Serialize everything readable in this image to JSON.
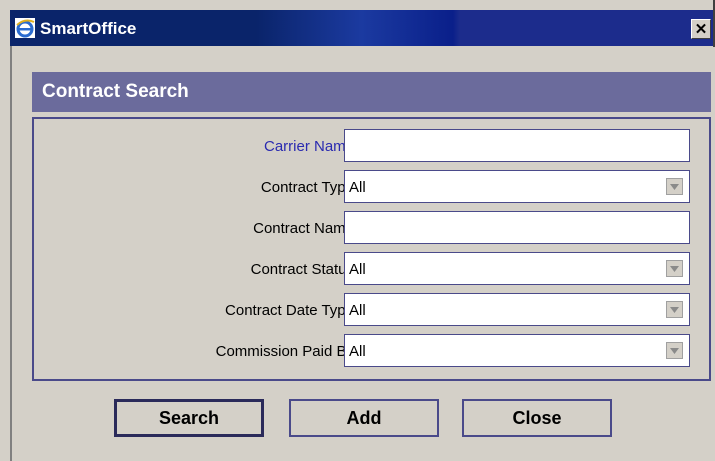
{
  "window": {
    "title": "SmartOffice",
    "close_glyph": "✕"
  },
  "section": {
    "title": "Contract Search"
  },
  "form": {
    "carrier_name": {
      "label": "Carrier Name",
      "value": ""
    },
    "contract_type": {
      "label": "Contract Type",
      "value": "All"
    },
    "contract_name": {
      "label": "Contract Name",
      "value": ""
    },
    "contract_status": {
      "label": "Contract Status",
      "value": "All"
    },
    "contract_date_type": {
      "label": "Contract Date Type",
      "value": "All"
    },
    "commission_paid_by": {
      "label": "Commission Paid By",
      "value": "All"
    }
  },
  "buttons": {
    "search": "Search",
    "add": "Add",
    "close": "Close"
  },
  "colors": {
    "title_bar": "#0a246a",
    "section_header": "#6b6b9c",
    "panel_border": "#4a4a8a",
    "link_label": "#2a2ab0"
  },
  "icons": {
    "app": "ie-icon",
    "close": "close-icon",
    "dropdown": "chevron-down-icon"
  }
}
